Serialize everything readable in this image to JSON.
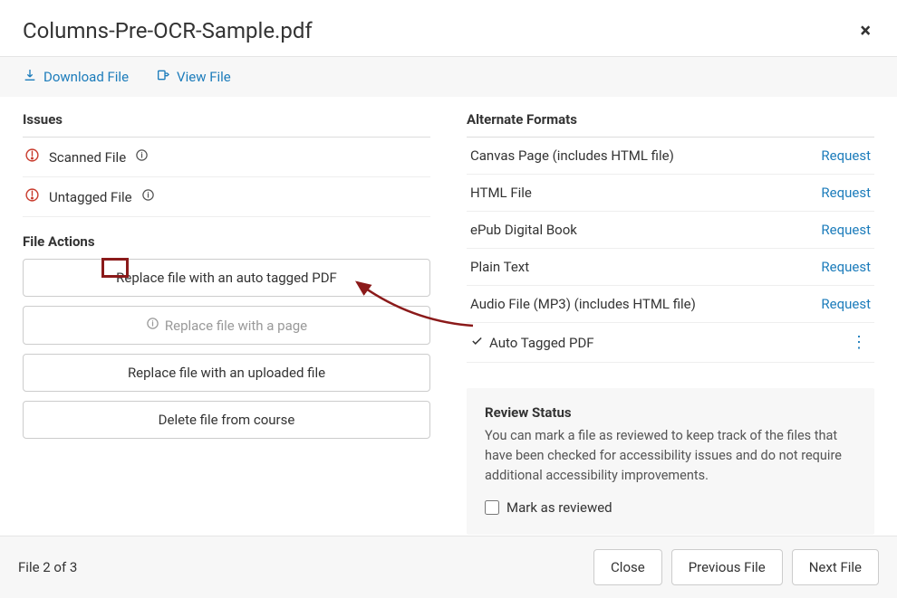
{
  "header": {
    "title": "Columns-Pre-OCR-Sample.pdf"
  },
  "toolbar": {
    "download": "Download File",
    "view": "View File"
  },
  "issues": {
    "title": "Issues",
    "items": [
      {
        "label": "Scanned File"
      },
      {
        "label": "Untagged File"
      }
    ]
  },
  "fileActions": {
    "title": "File Actions",
    "replaceAutoTagged": "Replace file with an auto tagged PDF",
    "replacePage": "Replace file with a page",
    "replaceUpload": "Replace file with an uploaded file",
    "deleteFile": "Delete file from course"
  },
  "formats": {
    "title": "Alternate Formats",
    "items": [
      {
        "label": "Canvas Page (includes HTML file)",
        "action": "Request"
      },
      {
        "label": "HTML File",
        "action": "Request"
      },
      {
        "label": "ePub Digital Book",
        "action": "Request"
      },
      {
        "label": "Plain Text",
        "action": "Request"
      },
      {
        "label": "Audio File (MP3) (includes HTML file)",
        "action": "Request"
      }
    ],
    "autoTagged": "Auto Tagged PDF"
  },
  "review": {
    "title": "Review Status",
    "text": "You can mark a file as reviewed to keep track of the files that have been checked for accessibility issues and do not require additional accessibility improvements.",
    "checkbox": "Mark as reviewed"
  },
  "footer": {
    "pager": "File 2 of 3",
    "close": "Close",
    "prev": "Previous File",
    "next": "Next File"
  }
}
